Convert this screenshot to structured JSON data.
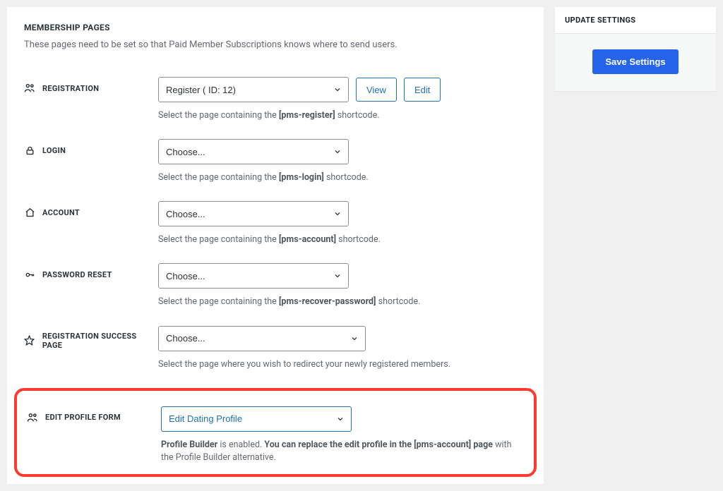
{
  "section": {
    "title": "MEMBERSHIP PAGES",
    "description": "These pages need to be set so that Paid Member Subscriptions knows where to send users."
  },
  "fields": {
    "registration": {
      "label": "REGISTRATION",
      "selected": "Register ( ID: 12)",
      "view_btn": "View",
      "edit_btn": "Edit",
      "help_prefix": "Select the page containing the ",
      "help_code": "[pms-register]",
      "help_suffix": " shortcode."
    },
    "login": {
      "label": "LOGIN",
      "selected": "Choose...",
      "help_prefix": "Select the page containing the ",
      "help_code": "[pms-login]",
      "help_suffix": " shortcode."
    },
    "account": {
      "label": "ACCOUNT",
      "selected": "Choose...",
      "help_prefix": "Select the page containing the ",
      "help_code": "[pms-account]",
      "help_suffix": " shortcode."
    },
    "password_reset": {
      "label": "PASSWORD RESET",
      "selected": "Choose...",
      "help_prefix": "Select the page containing the ",
      "help_code": "[pms-recover-password]",
      "help_suffix": " shortcode."
    },
    "reg_success": {
      "label": "REGISTRATION SUCCESS PAGE",
      "selected": "Choose...",
      "help": "Select the page where you wish to redirect your newly registered members."
    },
    "edit_profile": {
      "label": "EDIT PROFILE FORM",
      "selected": "Edit Dating Profile",
      "help_a": "Profile Builder",
      "help_b": " is enabled. ",
      "help_c": "You can replace the edit profile in the [pms-account] page",
      "help_d": " with the Profile Builder alternative."
    }
  },
  "sidebar": {
    "title": "UPDATE SETTINGS",
    "save_btn": "Save Settings"
  }
}
